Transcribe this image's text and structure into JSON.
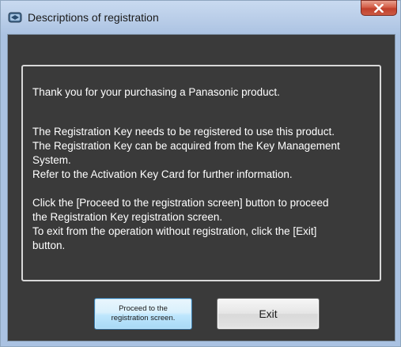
{
  "window": {
    "title": "Descriptions of registration",
    "icon": "registration-window-icon",
    "close_icon": "close-icon"
  },
  "description": {
    "thanks": "Thank you for your purchasing a Panasonic product.",
    "para2": [
      "The Registration Key needs to be registered to use this product.",
      "The Registration Key can be acquired from the Key Management",
      "System.",
      "Refer to the Activation Key Card for further information."
    ],
    "para3": [
      "Click the [Proceed to the registration screen] button to proceed",
      "the Registration Key registration screen.",
      "To exit from the operation without registration, click the [Exit]",
      "button."
    ]
  },
  "buttons": {
    "proceed_line1": "Proceed to the",
    "proceed_line2": "registration screen.",
    "exit": "Exit"
  },
  "colors": {
    "panel_bg": "#3a3a3a",
    "text": "#ffffff",
    "close_red": "#c0402c"
  }
}
